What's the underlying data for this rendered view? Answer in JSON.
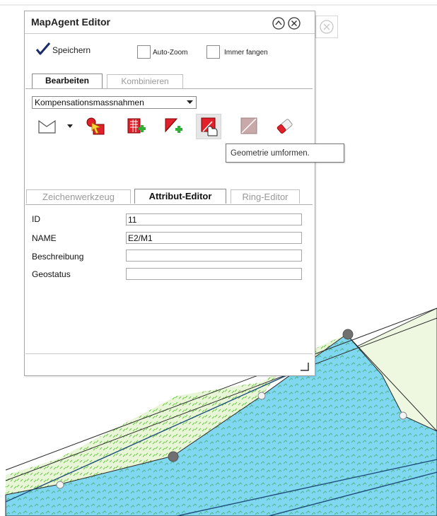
{
  "editor": {
    "title": "MapAgent Editor",
    "save_label": "Speichern",
    "auto_zoom_label": "Auto-Zoom",
    "snap_label": "Immer fangen",
    "auto_zoom_checked": false,
    "snap_checked": false,
    "top_tabs": [
      {
        "label": "Bearbeiten",
        "active": true
      },
      {
        "label": "Kombinieren",
        "active": false
      }
    ],
    "layer_select_value": "Kompensationsmassnahmen",
    "tools": [
      {
        "icon": "polygon-draw-icon",
        "has_dropdown": true
      },
      {
        "icon": "select-feature-icon"
      },
      {
        "icon": "add-attribute-icon"
      },
      {
        "icon": "add-vertex-icon"
      },
      {
        "icon": "reshape-geometry-icon",
        "hovered": true
      },
      {
        "icon": "split-geometry-icon",
        "disabled": true
      },
      {
        "icon": "eraser-icon"
      }
    ],
    "tooltip": "Geometrie umformen.",
    "bottom_tabs": [
      {
        "label": "Zeichenwerkzeug",
        "active": false
      },
      {
        "label": "Attribut-Editor",
        "active": true
      },
      {
        "label": "Ring-Editor",
        "active": false
      }
    ],
    "fields": [
      {
        "label": "ID",
        "value": "11"
      },
      {
        "label": "NAME",
        "value": "E2/M1"
      },
      {
        "label": "Beschreibung",
        "value": ""
      },
      {
        "label": "Geostatus",
        "value": ""
      }
    ]
  },
  "colors": {
    "water_fill": "#7fd8f0",
    "grass_fill": "#e8f5d6",
    "grass_hatch": "#6cc24a",
    "vertex_dark": "#707070",
    "vertex_light": "#f4f4f4"
  }
}
